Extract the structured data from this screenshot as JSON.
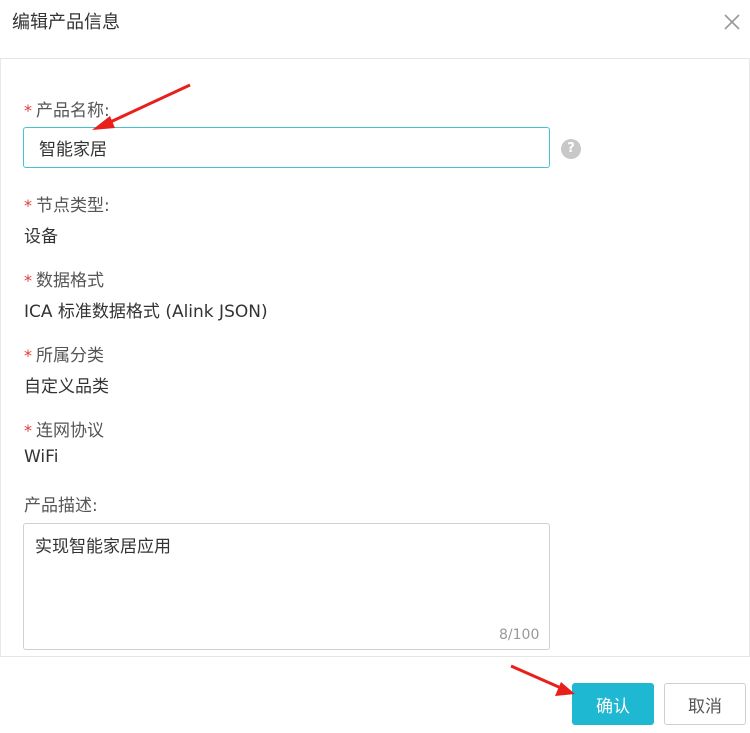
{
  "dialog": {
    "title": "编辑产品信息",
    "close_icon": "close-icon"
  },
  "form": {
    "product_name": {
      "label": "产品名称:",
      "value": "智能家居",
      "required": true,
      "help_icon": "help-icon",
      "help_text": "?"
    },
    "node_type": {
      "label": "节点类型:",
      "value": "设备",
      "required": true
    },
    "data_format": {
      "label": "数据格式",
      "value": "ICA 标准数据格式 (Alink JSON)",
      "required": true
    },
    "category": {
      "label": "所属分类",
      "value": "自定义品类",
      "required": true
    },
    "network_protocol": {
      "label": "连网协议",
      "value": "WiFi",
      "required": true
    },
    "description": {
      "label": "产品描述:",
      "value": "实现智能家居应用",
      "counter": "8/100"
    },
    "required_mark": "*"
  },
  "footer": {
    "confirm_label": "确认",
    "cancel_label": "取消"
  },
  "colors": {
    "accent": "#1fb8d2",
    "required": "#e53935",
    "annotation_arrow": "#e8201b"
  }
}
